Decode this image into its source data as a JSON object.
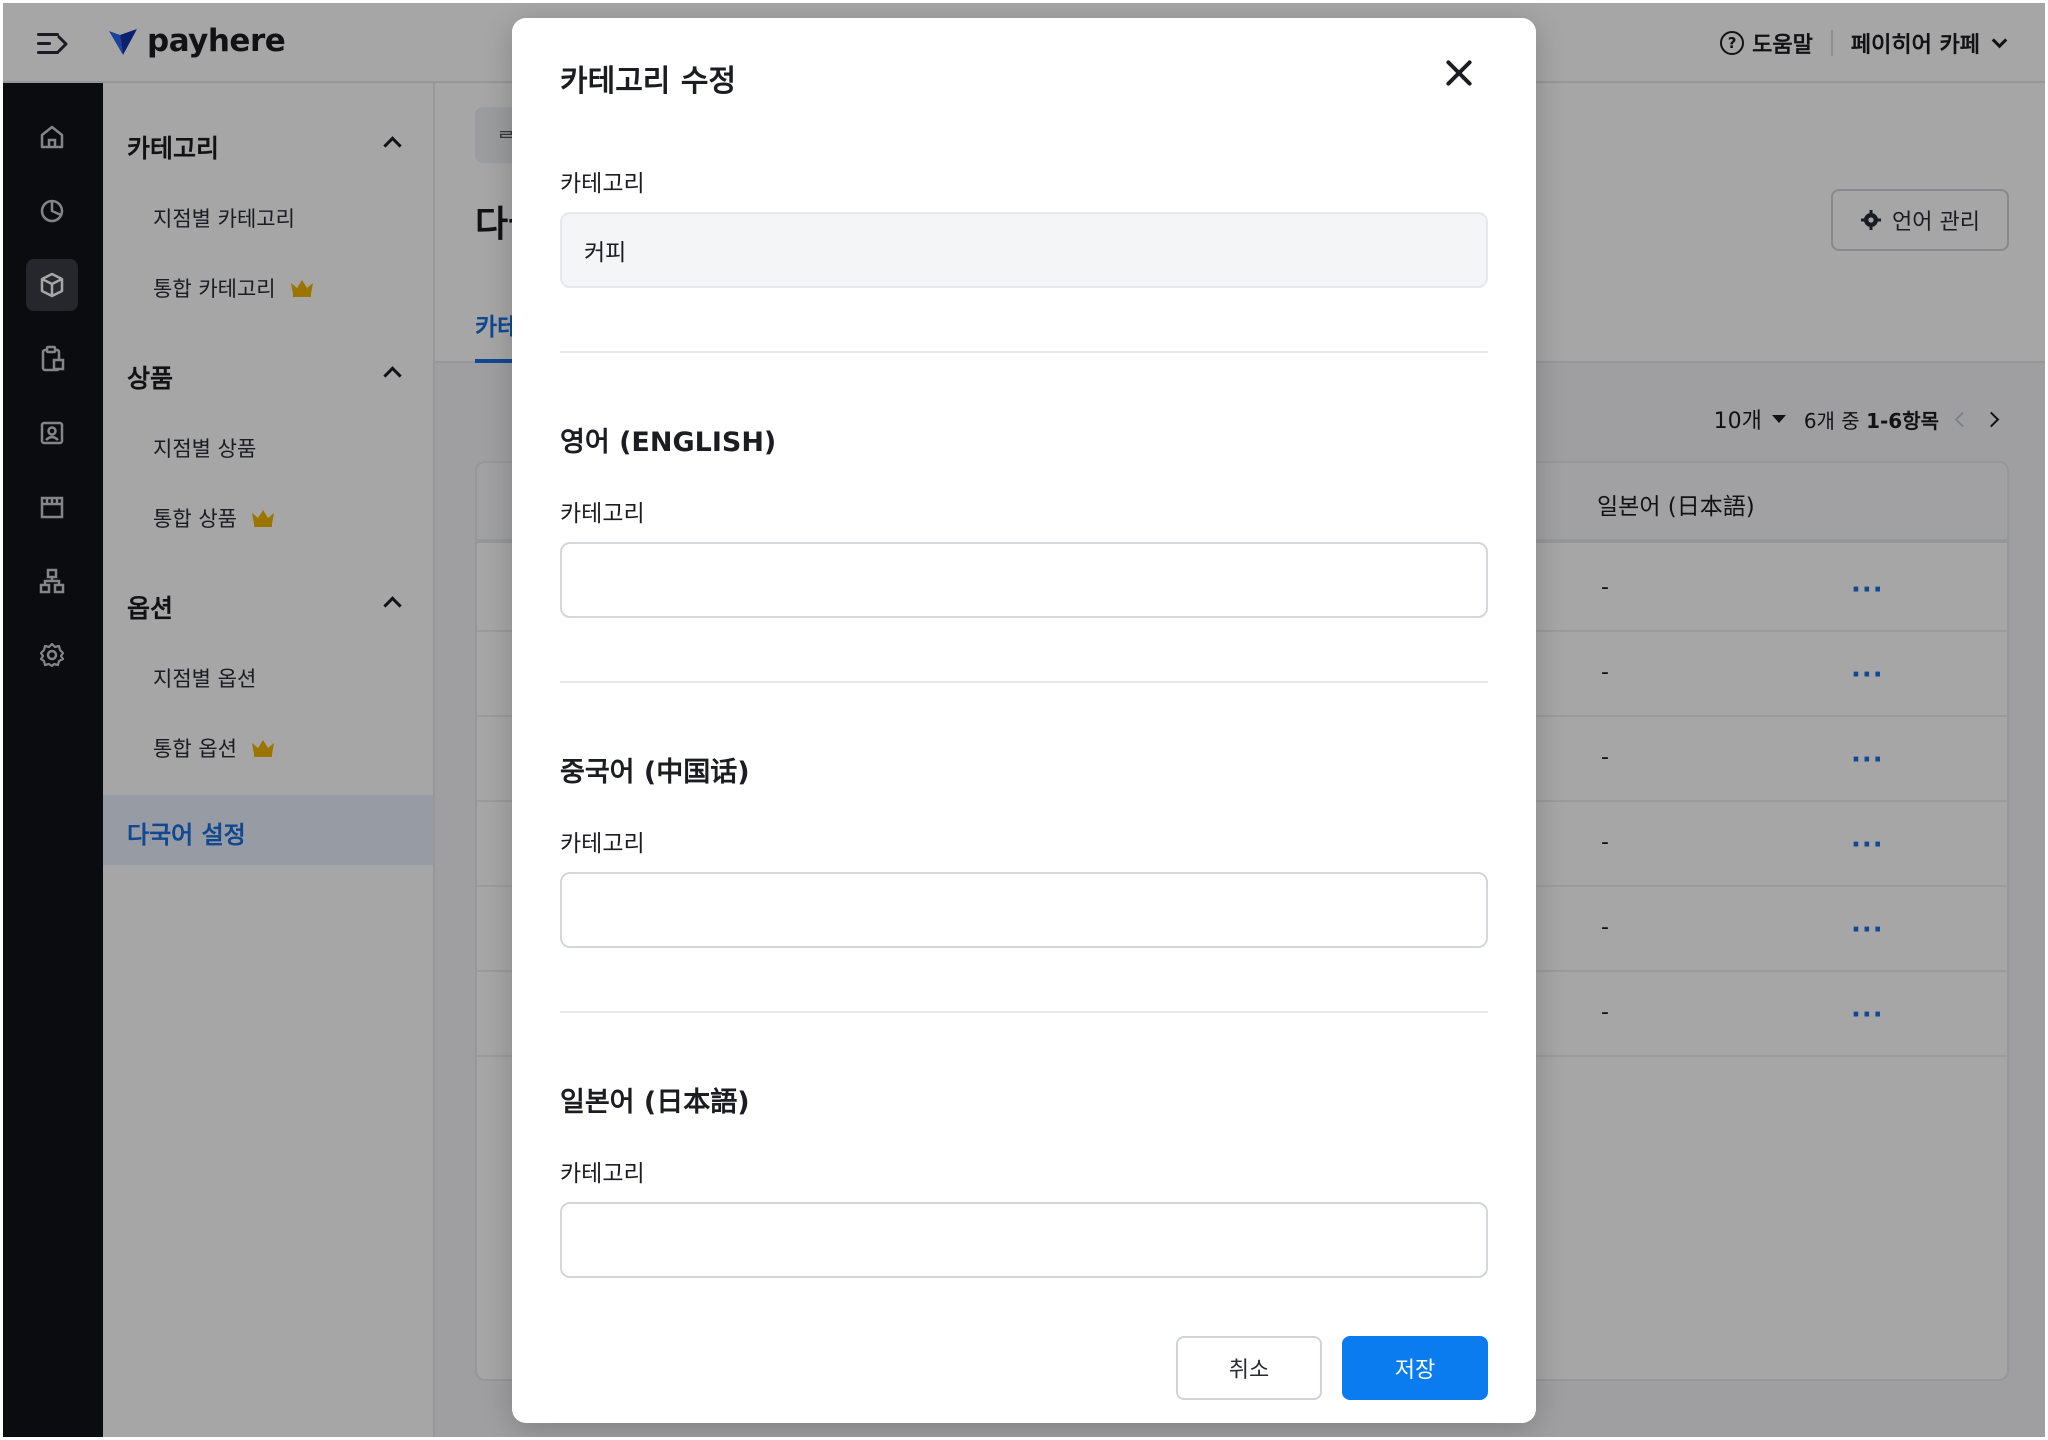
{
  "header": {
    "logo_text": "payhere",
    "help_label": "도움말",
    "help_icon": "?",
    "store_name": "페이히어 카페"
  },
  "rail": {
    "icons": [
      "home-icon",
      "chart-pie-icon",
      "box-icon",
      "clipboard-icon",
      "person-card-icon",
      "store-icon",
      "org-chart-icon",
      "gear-icon"
    ],
    "active_index": 2
  },
  "sidebar": {
    "groups": [
      {
        "label": "카테고리",
        "items": [
          "지점별 카테고리",
          "통합 카테고리"
        ]
      },
      {
        "label": "상품",
        "items": [
          "지점별 상품",
          "통합 상품"
        ]
      },
      {
        "label": "옵션",
        "items": [
          "지점별 옵션",
          "통합 옵션"
        ]
      }
    ],
    "active_item": "다국어 설정"
  },
  "main": {
    "breadcrumb": "ᄅ",
    "title": "다국어 설정",
    "tab": "카테고리",
    "lang_button": "언어 관리",
    "pager": {
      "per_page": "10개",
      "range_prefix": "6개 중",
      "range": "1-6항목"
    },
    "table": {
      "japanese_header": "일본어 (日本語)",
      "rows": [
        {
          "jp": "-",
          "more": "···"
        },
        {
          "jp": "-",
          "more": "···"
        },
        {
          "jp": "-",
          "more": "···"
        },
        {
          "jp": "-",
          "more": "···"
        },
        {
          "jp": "-",
          "more": "···"
        },
        {
          "jp": "-",
          "more": "···"
        }
      ]
    }
  },
  "modal": {
    "title": "카테고리 수정",
    "base": {
      "label": "카테고리",
      "value": "커피"
    },
    "english": {
      "section": "영어 (ENGLISH)",
      "label": "카테고리",
      "value": ""
    },
    "chinese": {
      "section": "중국어 (中国话)",
      "label": "카테고리",
      "value": ""
    },
    "japanese": {
      "section": "일본어 (日本語)",
      "label": "카테고리",
      "value": ""
    },
    "cancel_label": "취소",
    "save_label": "저장"
  },
  "colors": {
    "accent": "#0a7cf0",
    "link": "#1a6fe0",
    "rail_bg": "#121317",
    "crown": "#f0b400"
  }
}
